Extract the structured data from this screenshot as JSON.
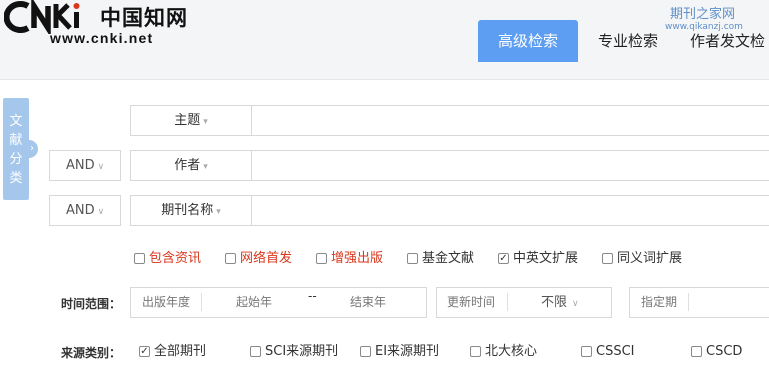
{
  "header": {
    "logo_url_text": "www.cnki.net",
    "logo_cn_text": "中国知网",
    "watermark_line1": "期刊之家网",
    "watermark_line2": "www.qikanzj.com",
    "tabs": [
      {
        "label": "高级检索",
        "active": true
      },
      {
        "label": "专业检索",
        "active": false
      },
      {
        "label": "作者发文检",
        "active": false
      }
    ],
    "accent_color": "#5e9ef2"
  },
  "side_tab": {
    "label": "文献分类"
  },
  "search_rows": [
    {
      "bool": "",
      "field": "主题",
      "value": ""
    },
    {
      "bool": "AND",
      "field": "作者",
      "value": ""
    },
    {
      "bool": "AND",
      "field": "期刊名称",
      "value": ""
    }
  ],
  "options": [
    {
      "label": "包含资讯",
      "checked": false,
      "color": "#d9371c"
    },
    {
      "label": "网络首发",
      "checked": false,
      "color": "#d9371c"
    },
    {
      "label": "增强出版",
      "checked": false,
      "color": "#d9371c"
    },
    {
      "label": "基金文献",
      "checked": false,
      "color": "#333333"
    },
    {
      "label": "中英文扩展",
      "checked": true,
      "color": "#333333"
    },
    {
      "label": "同义词扩展",
      "checked": false,
      "color": "#333333"
    }
  ],
  "time": {
    "label": "时间范围：",
    "pub_year": "出版年度",
    "start_year": "起始年",
    "separator": "--",
    "end_year": "结束年",
    "update_label": "更新时间",
    "update_value": "不限",
    "period_label": "指定期"
  },
  "source": {
    "label": "来源类别：",
    "items": [
      {
        "label": "全部期刊",
        "checked": true
      },
      {
        "label": "SCI来源期刊",
        "checked": false
      },
      {
        "label": "EI来源期刊",
        "checked": false
      },
      {
        "label": "北大核心",
        "checked": false
      },
      {
        "label": "CSSCI",
        "checked": false
      },
      {
        "label": "CSCD",
        "checked": false
      }
    ]
  }
}
